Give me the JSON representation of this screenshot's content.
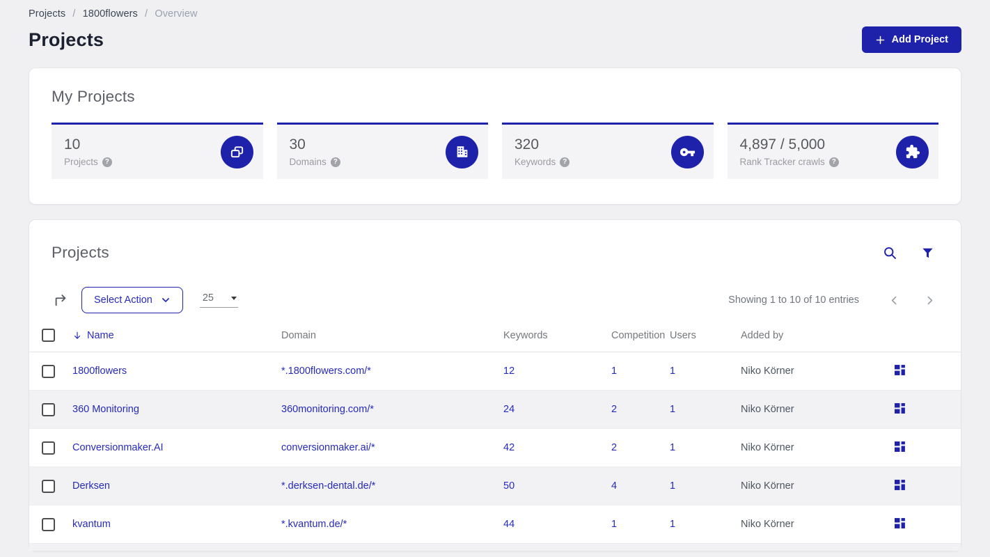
{
  "colors": {
    "accent": "#1e22aa",
    "link": "#262abd"
  },
  "breadcrumb": {
    "separator": "/",
    "items": [
      {
        "label": "Projects"
      },
      {
        "label": "1800flowers"
      },
      {
        "label": "Overview"
      }
    ]
  },
  "page": {
    "title": "Projects"
  },
  "header": {
    "add_project_label": "Add Project",
    "add_project_icon": "plus-icon"
  },
  "my_projects": {
    "title": "My Projects",
    "stats": [
      {
        "value": "10",
        "label": "Projects",
        "icon": "projects-copy-icon",
        "help_icon": "help-icon"
      },
      {
        "value": "30",
        "label": "Domains",
        "icon": "building-icon",
        "help_icon": "help-icon"
      },
      {
        "value": "320",
        "label": "Keywords",
        "icon": "key-icon",
        "help_icon": "help-icon"
      },
      {
        "value": "4,897 / 5,000",
        "label": "Rank Tracker crawls",
        "icon": "puzzle-icon",
        "help_icon": "help-icon"
      }
    ]
  },
  "projects_panel": {
    "title": "Projects",
    "toolbar_icons": [
      "search-icon",
      "filter-icon"
    ],
    "export_icon": "corner-up-right-icon",
    "select_action_label": "Select Action",
    "page_size": "25",
    "showing_text": "Showing 1 to 10 of 10 entries",
    "pagination_icons": [
      "chevron-left-icon",
      "chevron-right-icon"
    ],
    "sort": {
      "column": "Name",
      "direction": "desc",
      "icon": "sort-desc-icon"
    },
    "columns": [
      "Name",
      "Domain",
      "Keywords",
      "Competition",
      "Users",
      "Added by"
    ],
    "rows": [
      {
        "name": "1800flowers",
        "domain": "*.1800flowers.com/*",
        "keywords": "12",
        "competition": "1",
        "users": "1",
        "added_by": "Niko Körner"
      },
      {
        "name": "360 Monitoring",
        "domain": "360monitoring.com/*",
        "keywords": "24",
        "competition": "2",
        "users": "1",
        "added_by": "Niko Körner"
      },
      {
        "name": "Conversionmaker.AI",
        "domain": "conversionmaker.ai/*",
        "keywords": "42",
        "competition": "2",
        "users": "1",
        "added_by": "Niko Körner"
      },
      {
        "name": "Derksen",
        "domain": "*.derksen-dental.de/*",
        "keywords": "50",
        "competition": "4",
        "users": "1",
        "added_by": "Niko Körner"
      },
      {
        "name": "kvantum",
        "domain": "*.kvantum.de/*",
        "keywords": "44",
        "competition": "1",
        "users": "1",
        "added_by": "Niko Körner"
      }
    ]
  }
}
